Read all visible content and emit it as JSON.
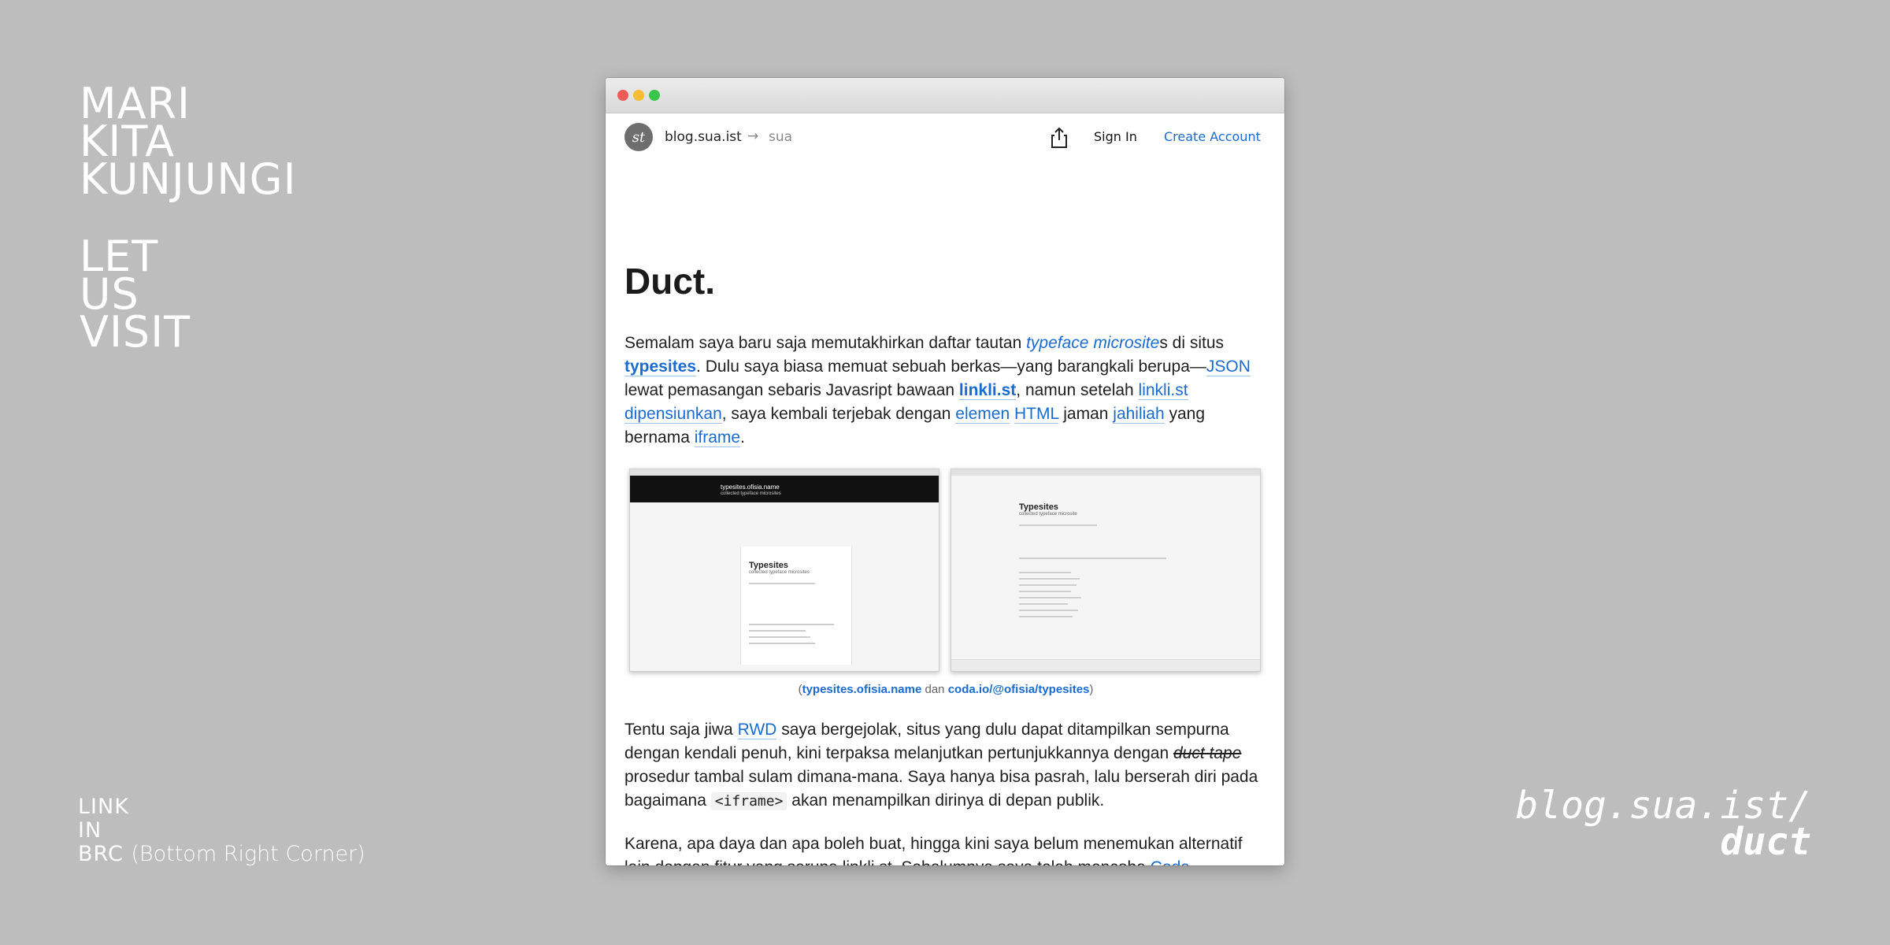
{
  "poster": {
    "headline_id": [
      "MARI",
      "KITA",
      "KUNJUNGI"
    ],
    "headline_en": [
      "LET",
      "US",
      "VISIT"
    ],
    "link_in": [
      "LINK",
      "IN",
      "BRC"
    ],
    "link_note": "(Bottom Right Corner)",
    "url_line1": "blog.sua.ist/",
    "url_line2": "duct"
  },
  "navbar": {
    "avatar": "st",
    "site": "blog.sua.ist",
    "arrow": "→",
    "user": "sua",
    "signin": "Sign In",
    "create_account": "Create Account"
  },
  "article": {
    "title": "Duct.",
    "p1": [
      "Semalam saya baru saja memutakhirkan daftar tautan ",
      "typeface microsite",
      "s di situs ",
      "typesites",
      ". Dulu saya biasa memuat sebuah berkas—yang barangkali berupa—",
      "JSON",
      " lewat pemasangan sebaris Javasript bawaan ",
      "linkli.st",
      ", namun setelah ",
      "linkli.st dipensiunkan",
      ", saya kembali terjebak dengan ",
      "elemen",
      " ",
      "HTML",
      " jaman ",
      "jahiliah",
      " yang bernama ",
      "iframe",
      "."
    ],
    "screenshots": {
      "left_header": "typesites.ofisia.name",
      "left_sub": "collected typeface microsites",
      "left_title": "Typesites",
      "left_subtitle": "collected typeface microsites",
      "right_title": "Typesites",
      "right_subtitle": "collected typeface microsite"
    },
    "caption": [
      "(",
      "typesites.ofisia.name",
      " dan ",
      "coda.io/@ofisia/typesites",
      ")"
    ],
    "p2": [
      "Tentu saja jiwa ",
      "RWD",
      " saya bergejolak, situs yang dulu dapat ditampilkan sempurna dengan kendali penuh, kini terpaksa melanjutkan pertunjukkannya dengan ",
      "duct tape",
      " prosedur tambal sulam dimana-mana. Saya hanya bisa pasrah, lalu berserah diri pada bagaimana ",
      "<iframe>",
      " akan menampilkan dirinya di depan publik."
    ],
    "p3": [
      "Karena, apa daya dan apa boleh buat, hingga kini saya belum menemukan alternatif lain dengan fitur yang serupa linkli.st. Sebelumnya saya telah mencoba ",
      "Coda"
    ]
  },
  "colors": {
    "background": "#bdbdbd",
    "link": "#1a6bd1",
    "window_close": "#ee5d55",
    "window_minimize": "#f4bd33",
    "window_zoom": "#39c54a"
  }
}
